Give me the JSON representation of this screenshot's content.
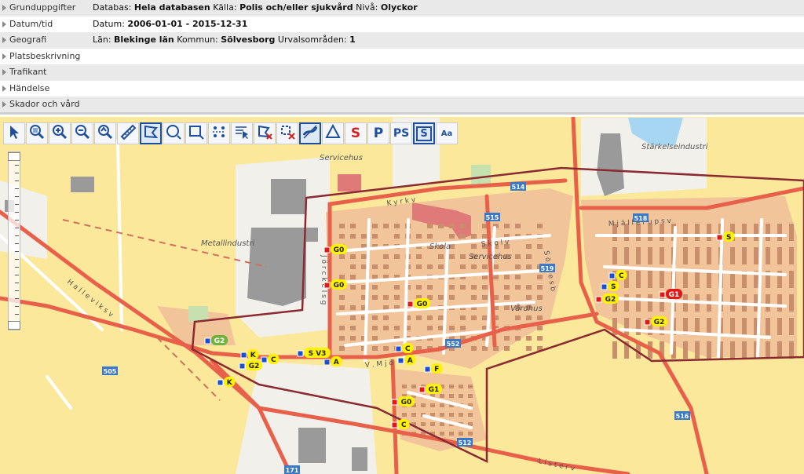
{
  "filters": [
    {
      "label": "Grunduppgifter",
      "parts": [
        {
          "t": "Databas: "
        },
        {
          "t": "Hela databasen",
          "b": true
        },
        {
          "t": " Källa: "
        },
        {
          "t": "Polis och/eller sjukvård",
          "b": true
        },
        {
          "t": " Nivå: "
        },
        {
          "t": "Olyckor",
          "b": true
        }
      ]
    },
    {
      "label": "Datum/tid",
      "parts": [
        {
          "t": "Datum: "
        },
        {
          "t": "2006-01-01 - 2015-12-31",
          "b": true
        }
      ]
    },
    {
      "label": "Geografi",
      "parts": [
        {
          "t": "Län: "
        },
        {
          "t": "Blekinge län",
          "b": true
        },
        {
          "t": " Kommun: "
        },
        {
          "t": "Sölvesborg",
          "b": true
        },
        {
          "t": " Urvalsområden: "
        },
        {
          "t": "1",
          "b": true
        }
      ]
    },
    {
      "label": "Platsbeskrivning",
      "parts": []
    },
    {
      "label": "Trafikant",
      "parts": []
    },
    {
      "label": "Händelse",
      "parts": []
    },
    {
      "label": "Skador och vård",
      "parts": []
    }
  ],
  "toolbar": [
    {
      "name": "select-arrow-tool",
      "icon": "arrow-cursor",
      "text": ""
    },
    {
      "name": "zoom-extent-tool",
      "icon": "magnifier-map",
      "text": ""
    },
    {
      "name": "zoom-in-tool",
      "icon": "magnifier-plus",
      "text": ""
    },
    {
      "name": "zoom-out-tool",
      "icon": "magnifier-minus",
      "text": ""
    },
    {
      "name": "zoom-previous-tool",
      "icon": "magnifier-arrow",
      "text": ""
    },
    {
      "name": "measure-tool",
      "icon": "ruler",
      "text": ""
    },
    {
      "name": "polygon-select-tool",
      "icon": "polygon",
      "text": "",
      "active": true
    },
    {
      "name": "circle-select-tool",
      "icon": "circle",
      "text": ""
    },
    {
      "name": "rectangle-select-tool",
      "icon": "rectangle",
      "text": ""
    },
    {
      "name": "move-points-tool",
      "icon": "dots",
      "text": ""
    },
    {
      "name": "select-objects-tool",
      "icon": "list-cursor",
      "text": ""
    },
    {
      "name": "clear-polygon-tool",
      "icon": "polygon-x",
      "text": ""
    },
    {
      "name": "clear-selection-tool",
      "icon": "select-x",
      "text": ""
    },
    {
      "name": "show-roads-tool",
      "icon": "roads",
      "text": "",
      "active": true
    },
    {
      "name": "triangle-tool",
      "icon": "triangle",
      "text": ""
    },
    {
      "name": "symbol-s-tool",
      "icon": "letter",
      "text": "S",
      "red": true
    },
    {
      "name": "symbol-p-tool",
      "icon": "letter",
      "text": "P"
    },
    {
      "name": "symbol-ps-tool",
      "icon": "letter",
      "text": "PS"
    },
    {
      "name": "symbol-s-box-tool",
      "icon": "letter-box",
      "text": "S",
      "active": true
    },
    {
      "name": "search-text-tool",
      "icon": "magnifier-aa",
      "text": "Aa"
    }
  ],
  "map": {
    "place_labels": [
      "Servicehus",
      "Metallindustri",
      "Skola",
      "Servicehus",
      "Vårdhus",
      "Stärkelseindustri"
    ],
    "street_labels": [
      "K y r k v",
      "J ö r c k e l s g",
      "M j ä l l e r u p s v",
      "S k o l v",
      "S ö l v e s b",
      "H a l l e v i k s v",
      "V . M j ö",
      "L i s t e r v"
    ],
    "road_numbers": [
      "514",
      "515",
      "518",
      "519",
      "552",
      "505",
      "512",
      "516",
      "171"
    ],
    "accident_markers": [
      "G0",
      "G0",
      "G0",
      "G2",
      "K",
      "G2",
      "C",
      "S V3",
      "A",
      "C",
      "A",
      "F",
      "G1",
      "G0",
      "C",
      "S",
      "S",
      "C",
      "G2",
      "G1",
      "G2",
      "K"
    ]
  }
}
